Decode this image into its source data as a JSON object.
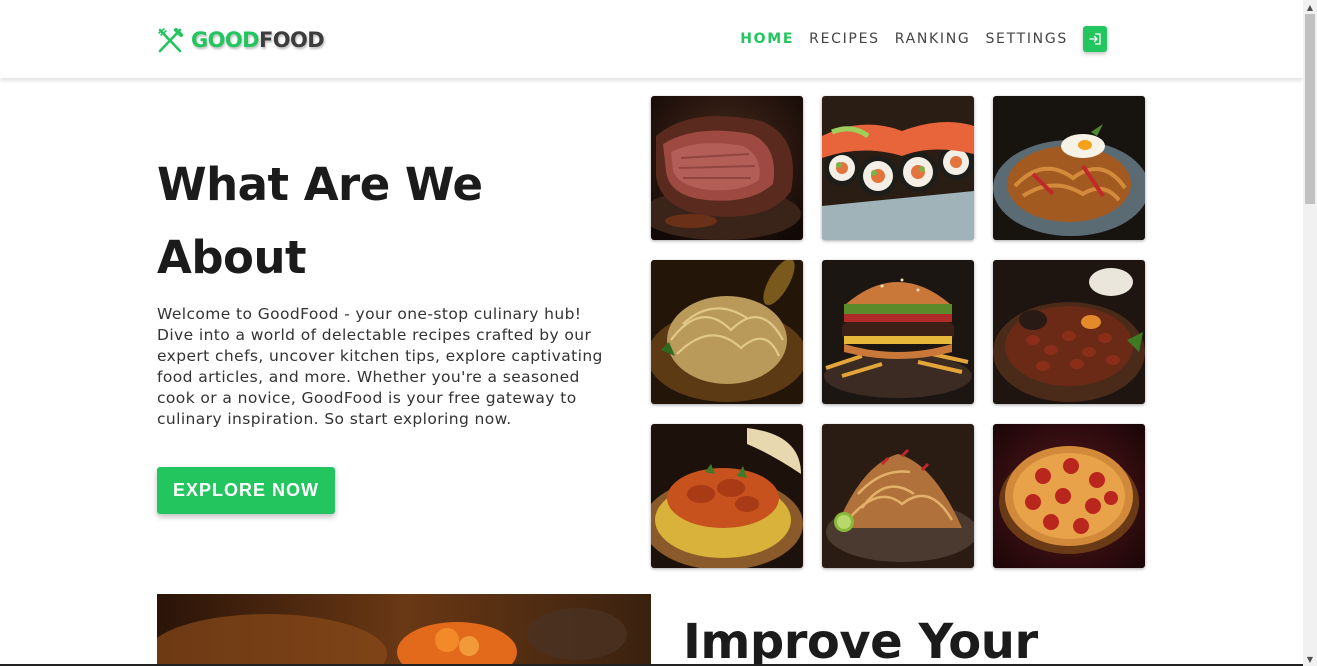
{
  "brand": {
    "good": "GOOD",
    "food": "FOOD",
    "accent": "#22c55e",
    "icon": "fork-knife-icon"
  },
  "nav": {
    "items": [
      {
        "label": "HOME",
        "active": true
      },
      {
        "label": "RECIPES",
        "active": false
      },
      {
        "label": "RANKING",
        "active": false
      },
      {
        "label": "SETTINGS",
        "active": false
      }
    ],
    "login_icon": "login-icon"
  },
  "hero": {
    "title": "What Are We About",
    "text": "Welcome to GoodFood - your one-stop culinary hub! Dive into a world of delectable recipes crafted by our expert chefs, uncover kitchen tips, explore captivating food articles, and more. Whether you're a seasoned cook or a novice, GoodFood is your free gateway to culinary inspiration. So start exploring now.",
    "button": "EXPLORE NOW"
  },
  "gallery": {
    "images": [
      "steak",
      "sushi-rolls",
      "stir-fried-noodles",
      "spaghetti",
      "burger-and-fries",
      "bean-stew",
      "butter-chicken",
      "pad-thai",
      "pepperoni-pizza"
    ]
  },
  "next_section": {
    "title": "Improve Your"
  }
}
